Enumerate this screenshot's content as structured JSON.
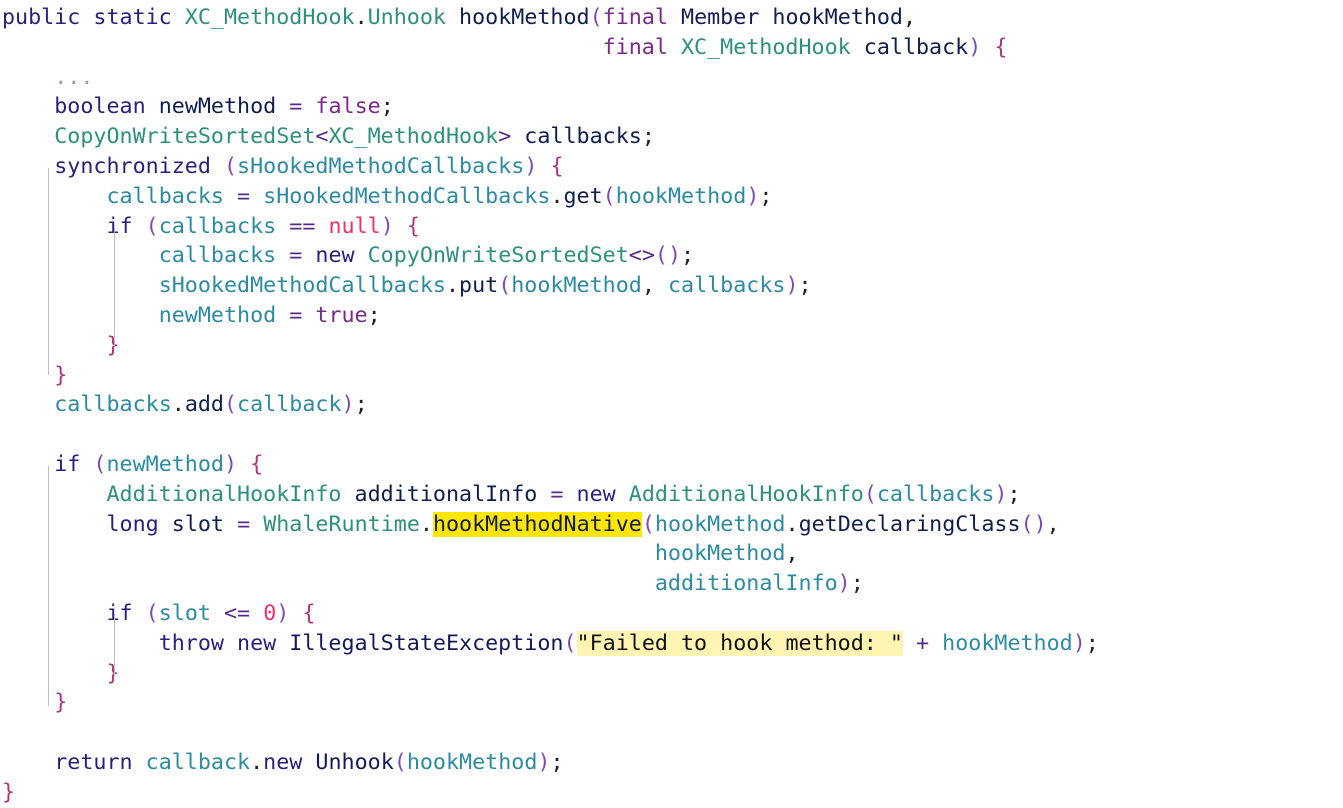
{
  "code": {
    "lines": [
      [
        {
          "t": "public static ",
          "c": "kw"
        },
        {
          "t": "XC_MethodHook",
          "c": "type"
        },
        {
          "t": ".",
          "c": "punct"
        },
        {
          "t": "Unhook",
          "c": "type"
        },
        {
          "t": " ",
          "c": "plain"
        },
        {
          "t": "hookMethod",
          "c": "call"
        },
        {
          "t": "(",
          "c": "paren"
        },
        {
          "t": "final ",
          "c": "lit"
        },
        {
          "t": "Member",
          "c": "id"
        },
        {
          "t": " hookMethod",
          "c": "call"
        },
        {
          "t": ",",
          "c": "punct"
        }
      ],
      [
        {
          "t": "                                              ",
          "c": "plain"
        },
        {
          "t": "final ",
          "c": "lit"
        },
        {
          "t": "XC_MethodHook",
          "c": "type"
        },
        {
          "t": " callback",
          "c": "call"
        },
        {
          "t": ")",
          "c": "paren"
        },
        {
          "t": " ",
          "c": "plain"
        },
        {
          "t": "{",
          "c": "brace"
        }
      ],
      [
        {
          "t": "    ",
          "c": "plain"
        },
        {
          "t": "...",
          "c": "dim"
        }
      ],
      [
        {
          "t": "    ",
          "c": "plain"
        },
        {
          "t": "boolean ",
          "c": "kw"
        },
        {
          "t": "newMethod",
          "c": "call"
        },
        {
          "t": " ",
          "c": "plain"
        },
        {
          "t": "=",
          "c": "op"
        },
        {
          "t": " ",
          "c": "plain"
        },
        {
          "t": "false",
          "c": "lit"
        },
        {
          "t": ";",
          "c": "punct"
        }
      ],
      [
        {
          "t": "    ",
          "c": "plain"
        },
        {
          "t": "CopyOnWriteSortedSet",
          "c": "type"
        },
        {
          "t": "<",
          "c": "op"
        },
        {
          "t": "XC_MethodHook",
          "c": "type"
        },
        {
          "t": ">",
          "c": "op"
        },
        {
          "t": " callbacks",
          "c": "call"
        },
        {
          "t": ";",
          "c": "punct"
        }
      ],
      [
        {
          "t": "    ",
          "c": "plain"
        },
        {
          "t": "synchronized ",
          "c": "kw"
        },
        {
          "t": "(",
          "c": "paren"
        },
        {
          "t": "sHookedMethodCallbacks",
          "c": "var"
        },
        {
          "t": ")",
          "c": "paren"
        },
        {
          "t": " ",
          "c": "plain"
        },
        {
          "t": "{",
          "c": "brace"
        }
      ],
      [
        {
          "t": "        ",
          "c": "plain"
        },
        {
          "t": "callbacks",
          "c": "var"
        },
        {
          "t": " ",
          "c": "plain"
        },
        {
          "t": "=",
          "c": "op"
        },
        {
          "t": " ",
          "c": "plain"
        },
        {
          "t": "sHookedMethodCallbacks",
          "c": "var"
        },
        {
          "t": ".",
          "c": "punct"
        },
        {
          "t": "get",
          "c": "call"
        },
        {
          "t": "(",
          "c": "paren"
        },
        {
          "t": "hookMethod",
          "c": "var"
        },
        {
          "t": ")",
          "c": "paren"
        },
        {
          "t": ";",
          "c": "punct"
        }
      ],
      [
        {
          "t": "        ",
          "c": "plain"
        },
        {
          "t": "if ",
          "c": "kw"
        },
        {
          "t": "(",
          "c": "paren"
        },
        {
          "t": "callbacks",
          "c": "var"
        },
        {
          "t": " ",
          "c": "plain"
        },
        {
          "t": "==",
          "c": "op"
        },
        {
          "t": " ",
          "c": "plain"
        },
        {
          "t": "null",
          "c": "null"
        },
        {
          "t": ")",
          "c": "paren"
        },
        {
          "t": " ",
          "c": "plain"
        },
        {
          "t": "{",
          "c": "brace"
        }
      ],
      [
        {
          "t": "            ",
          "c": "plain"
        },
        {
          "t": "callbacks",
          "c": "var"
        },
        {
          "t": " ",
          "c": "plain"
        },
        {
          "t": "=",
          "c": "op"
        },
        {
          "t": " ",
          "c": "plain"
        },
        {
          "t": "new ",
          "c": "kw"
        },
        {
          "t": "CopyOnWriteSortedSet",
          "c": "type"
        },
        {
          "t": "<>",
          "c": "op"
        },
        {
          "t": "()",
          "c": "paren"
        },
        {
          "t": ";",
          "c": "punct"
        }
      ],
      [
        {
          "t": "            ",
          "c": "plain"
        },
        {
          "t": "sHookedMethodCallbacks",
          "c": "var"
        },
        {
          "t": ".",
          "c": "punct"
        },
        {
          "t": "put",
          "c": "call"
        },
        {
          "t": "(",
          "c": "paren"
        },
        {
          "t": "hookMethod",
          "c": "var"
        },
        {
          "t": ", ",
          "c": "punct"
        },
        {
          "t": "callbacks",
          "c": "var"
        },
        {
          "t": ")",
          "c": "paren"
        },
        {
          "t": ";",
          "c": "punct"
        }
      ],
      [
        {
          "t": "            ",
          "c": "plain"
        },
        {
          "t": "newMethod",
          "c": "var"
        },
        {
          "t": " ",
          "c": "plain"
        },
        {
          "t": "=",
          "c": "op"
        },
        {
          "t": " ",
          "c": "plain"
        },
        {
          "t": "true",
          "c": "lit"
        },
        {
          "t": ";",
          "c": "punct"
        }
      ],
      [
        {
          "t": "        ",
          "c": "plain"
        },
        {
          "t": "}",
          "c": "brace"
        }
      ],
      [
        {
          "t": "    ",
          "c": "plain"
        },
        {
          "t": "}",
          "c": "brace"
        }
      ],
      [
        {
          "t": "    ",
          "c": "plain"
        },
        {
          "t": "callbacks",
          "c": "var"
        },
        {
          "t": ".",
          "c": "punct"
        },
        {
          "t": "add",
          "c": "call"
        },
        {
          "t": "(",
          "c": "paren"
        },
        {
          "t": "callback",
          "c": "var"
        },
        {
          "t": ")",
          "c": "paren"
        },
        {
          "t": ";",
          "c": "punct"
        }
      ],
      [],
      [
        {
          "t": "    ",
          "c": "plain"
        },
        {
          "t": "if ",
          "c": "kw"
        },
        {
          "t": "(",
          "c": "paren"
        },
        {
          "t": "newMethod",
          "c": "var"
        },
        {
          "t": ")",
          "c": "paren"
        },
        {
          "t": " ",
          "c": "plain"
        },
        {
          "t": "{",
          "c": "brace"
        }
      ],
      [
        {
          "t": "        ",
          "c": "plain"
        },
        {
          "t": "AdditionalHookInfo",
          "c": "type"
        },
        {
          "t": " additionalInfo",
          "c": "call"
        },
        {
          "t": " ",
          "c": "plain"
        },
        {
          "t": "=",
          "c": "op"
        },
        {
          "t": " ",
          "c": "plain"
        },
        {
          "t": "new ",
          "c": "kw"
        },
        {
          "t": "AdditionalHookInfo",
          "c": "type"
        },
        {
          "t": "(",
          "c": "paren"
        },
        {
          "t": "callbacks",
          "c": "var"
        },
        {
          "t": ")",
          "c": "paren"
        },
        {
          "t": ";",
          "c": "punct"
        }
      ],
      [
        {
          "t": "        ",
          "c": "plain"
        },
        {
          "t": "long ",
          "c": "kw"
        },
        {
          "t": "slot",
          "c": "call"
        },
        {
          "t": " ",
          "c": "plain"
        },
        {
          "t": "=",
          "c": "op"
        },
        {
          "t": " ",
          "c": "plain"
        },
        {
          "t": "WhaleRuntime",
          "c": "type"
        },
        {
          "t": ".",
          "c": "punct"
        },
        {
          "t": "hookMethodNative",
          "c": "call",
          "hl": "strong"
        },
        {
          "t": "(",
          "c": "paren"
        },
        {
          "t": "hookMethod",
          "c": "var"
        },
        {
          "t": ".",
          "c": "punct"
        },
        {
          "t": "getDeclaringClass",
          "c": "call"
        },
        {
          "t": "()",
          "c": "paren"
        },
        {
          "t": ",",
          "c": "punct"
        }
      ],
      [
        {
          "t": "                                                  ",
          "c": "plain"
        },
        {
          "t": "hookMethod",
          "c": "var"
        },
        {
          "t": ",",
          "c": "punct"
        }
      ],
      [
        {
          "t": "                                                  ",
          "c": "plain"
        },
        {
          "t": "additionalInfo",
          "c": "var"
        },
        {
          "t": ")",
          "c": "paren"
        },
        {
          "t": ";",
          "c": "punct"
        }
      ],
      [
        {
          "t": "        ",
          "c": "plain"
        },
        {
          "t": "if ",
          "c": "kw"
        },
        {
          "t": "(",
          "c": "paren"
        },
        {
          "t": "slot",
          "c": "var"
        },
        {
          "t": " ",
          "c": "plain"
        },
        {
          "t": "<=",
          "c": "op"
        },
        {
          "t": " ",
          "c": "plain"
        },
        {
          "t": "0",
          "c": "num"
        },
        {
          "t": ")",
          "c": "paren"
        },
        {
          "t": " ",
          "c": "plain"
        },
        {
          "t": "{",
          "c": "brace"
        }
      ],
      [
        {
          "t": "            ",
          "c": "plain"
        },
        {
          "t": "throw new ",
          "c": "kw"
        },
        {
          "t": "IllegalStateException",
          "c": "id"
        },
        {
          "t": "(",
          "c": "paren"
        },
        {
          "t": "\"Failed to hook method: \"",
          "c": "str",
          "hl": "soft"
        },
        {
          "t": " ",
          "c": "plain"
        },
        {
          "t": "+",
          "c": "op"
        },
        {
          "t": " ",
          "c": "plain"
        },
        {
          "t": "hookMethod",
          "c": "var"
        },
        {
          "t": ")",
          "c": "paren"
        },
        {
          "t": ";",
          "c": "punct"
        }
      ],
      [
        {
          "t": "        ",
          "c": "plain"
        },
        {
          "t": "}",
          "c": "brace"
        }
      ],
      [
        {
          "t": "    ",
          "c": "plain"
        },
        {
          "t": "}",
          "c": "brace"
        }
      ],
      [],
      [
        {
          "t": "    ",
          "c": "plain"
        },
        {
          "t": "return ",
          "c": "kw"
        },
        {
          "t": "callback",
          "c": "var"
        },
        {
          "t": ".",
          "c": "punct"
        },
        {
          "t": "new ",
          "c": "kw"
        },
        {
          "t": "Unhook",
          "c": "id"
        },
        {
          "t": "(",
          "c": "paren"
        },
        {
          "t": "hookMethod",
          "c": "var"
        },
        {
          "t": ")",
          "c": "paren"
        },
        {
          "t": ";",
          "c": "punct"
        }
      ],
      [
        {
          "t": "}",
          "c": "brace"
        }
      ]
    ]
  }
}
